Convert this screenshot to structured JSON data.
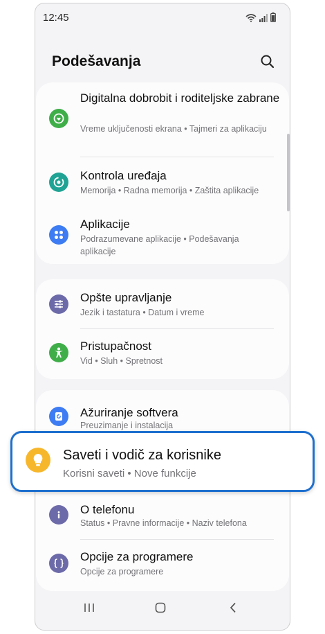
{
  "status_bar": {
    "time": "12:45"
  },
  "header": {
    "title": "Podešavanja",
    "search_icon": "search-icon"
  },
  "groups": [
    {
      "items": [
        {
          "title": "Digitalna dobrobit i roditeljske zabrane",
          "subtitle": "Vreme uključenosti ekrana  •  Tajmeri za aplikaciju",
          "icon": "digital-wellbeing-icon",
          "color": "#3fae49"
        },
        {
          "title": "Kontrola uređaja",
          "subtitle": "Memorija  •  Radna memorija  •  Zaštita aplikacije",
          "icon": "device-care-icon",
          "color": "#1fa394"
        },
        {
          "title": "Aplikacije",
          "subtitle": "Podrazumevane aplikacije  •  Podešavanja aplikacije",
          "icon": "apps-icon",
          "color": "#3d7cf2"
        }
      ]
    },
    {
      "items": [
        {
          "title": "Opšte upravljanje",
          "subtitle": "Jezik i tastatura  •  Datum i vreme",
          "icon": "general-management-icon",
          "color": "#6c6aa8"
        },
        {
          "title": "Pristupačnost",
          "subtitle": "Vid  •  Sluh  •  Spretnost",
          "icon": "accessibility-icon",
          "color": "#3fae49"
        }
      ]
    },
    {
      "items": [
        {
          "title": "Ažuriranje softvera",
          "subtitle": "Preuzimanje i instalacija",
          "icon": "software-update-icon",
          "color": "#3d7cf2"
        },
        {
          "title": "O telefonu",
          "subtitle": "Status  •  Pravne informacije  •  Naziv telefona",
          "icon": "info-icon",
          "color": "#6c6aa8"
        },
        {
          "title": "Opcije za programere",
          "subtitle": "Opcije za programere",
          "icon": "developer-options-icon",
          "color": "#6c6aa8"
        }
      ]
    }
  ],
  "highlighted": {
    "title": "Saveti i vodič za korisnike",
    "subtitle": "Korisni saveti  •  Nove funkcije",
    "icon": "lightbulb-icon",
    "color": "#f7b72d",
    "border_color": "#1e6fce"
  },
  "nav_bar": {
    "recents": "recents-icon",
    "home": "home-icon",
    "back": "back-icon"
  }
}
